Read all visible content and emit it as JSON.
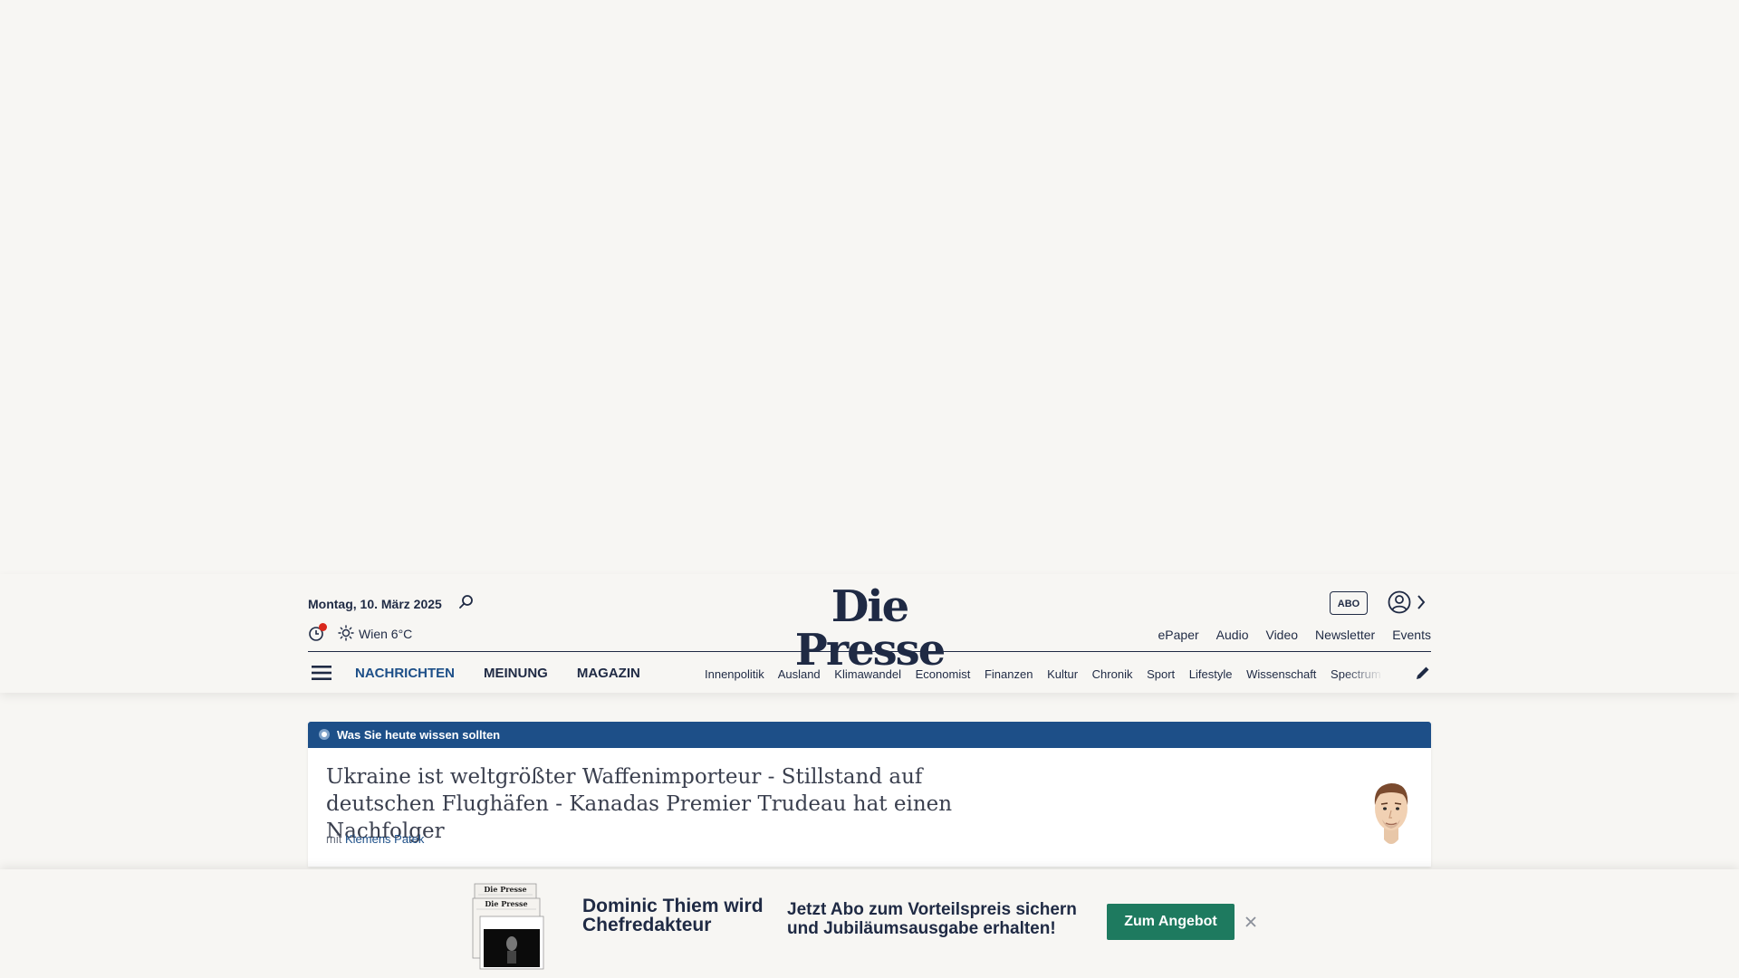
{
  "header": {
    "date": "Montag, 10. März 2025",
    "weather": "Wien 6°C",
    "logo": "Die Presse",
    "abo_label": "ABO",
    "top_links": [
      "ePaper",
      "Audio",
      "Video",
      "Newsletter",
      "Events"
    ],
    "main_nav": [
      "NACHRICHTEN",
      "MEINUNG",
      "MAGAZIN"
    ],
    "sub_nav": [
      "Innenpolitik",
      "Ausland",
      "Klimawandel",
      "Economist",
      "Finanzen",
      "Kultur",
      "Chronik",
      "Sport",
      "Lifestyle",
      "Wissenschaft",
      "Spectrum"
    ]
  },
  "briefing": {
    "label": "Was Sie heute wissen sollten",
    "headline": "Ukraine ist weltgrößter Waffenimporteur - Stillstand auf deutschen Flughäfen - Kanadas Premier Trudeau hat einen Nachfolger",
    "byline_prefix": "mit",
    "author": "Klemens Patek"
  },
  "banner": {
    "title": "Dominic Thiem wird Chefredakteur",
    "text": "Jetzt Abo zum Vorteilspreis sichern und Jubiläumsausgabe erhalten!",
    "button": "Zum Angebot",
    "paper_logo": "Die Presse"
  },
  "colors": {
    "background": "#f7f6f3",
    "navy": "#1f2a44",
    "accent_blue": "#1d4f88",
    "button_green": "#1e7a5f",
    "notification_red": "#d9281c"
  },
  "icons": [
    "search-icon",
    "clock-icon",
    "sun-icon",
    "user-icon",
    "chevron-right-icon",
    "menu-icon",
    "pencil-icon",
    "close-icon"
  ]
}
